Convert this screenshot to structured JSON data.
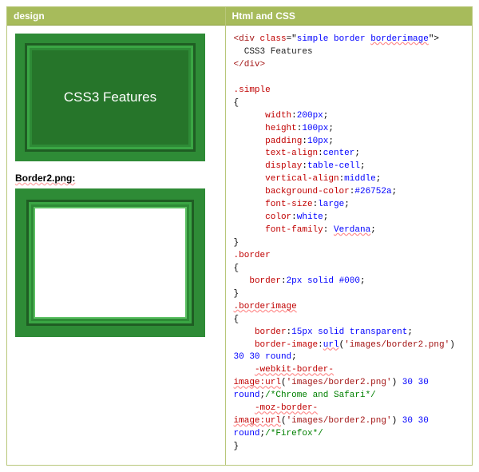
{
  "columns": {
    "left_header": "design",
    "right_header": "Html and CSS"
  },
  "design": {
    "feature_text": "CSS3 Features",
    "frame_label": "Border2.png:"
  },
  "code": {
    "tokens": [
      {
        "t": "tag",
        "v": "<div "
      },
      {
        "t": "attr",
        "v": "class"
      },
      {
        "t": "punc",
        "v": "=\""
      },
      {
        "t": "kw",
        "v": "simple border "
      },
      {
        "t": "kw squiggle",
        "v": "borderimage"
      },
      {
        "t": "punc",
        "v": "\">"
      },
      {
        "t": "nl"
      },
      {
        "t": "txt",
        "v": "  CSS3 Features"
      },
      {
        "t": "nl"
      },
      {
        "t": "tag",
        "v": "</div>"
      },
      {
        "t": "nl"
      },
      {
        "t": "nl"
      },
      {
        "t": "attr",
        "v": ".simple"
      },
      {
        "t": "nl"
      },
      {
        "t": "punc",
        "v": "{"
      },
      {
        "t": "nl"
      },
      {
        "t": "txt",
        "v": "      "
      },
      {
        "t": "attr",
        "v": "width"
      },
      {
        "t": "punc",
        "v": ":"
      },
      {
        "t": "kw",
        "v": "200px"
      },
      {
        "t": "punc",
        "v": ";"
      },
      {
        "t": "nl"
      },
      {
        "t": "txt",
        "v": "      "
      },
      {
        "t": "attr",
        "v": "height"
      },
      {
        "t": "punc",
        "v": ":"
      },
      {
        "t": "kw",
        "v": "100px"
      },
      {
        "t": "punc",
        "v": ";"
      },
      {
        "t": "nl"
      },
      {
        "t": "txt",
        "v": "      "
      },
      {
        "t": "attr",
        "v": "padding"
      },
      {
        "t": "punc",
        "v": ":"
      },
      {
        "t": "kw",
        "v": "10px"
      },
      {
        "t": "punc",
        "v": ";"
      },
      {
        "t": "nl"
      },
      {
        "t": "txt",
        "v": "      "
      },
      {
        "t": "attr",
        "v": "text-align"
      },
      {
        "t": "punc",
        "v": ":"
      },
      {
        "t": "kw",
        "v": "center"
      },
      {
        "t": "punc",
        "v": ";"
      },
      {
        "t": "nl"
      },
      {
        "t": "txt",
        "v": "      "
      },
      {
        "t": "attr",
        "v": "display"
      },
      {
        "t": "punc",
        "v": ":"
      },
      {
        "t": "kw",
        "v": "table-cell"
      },
      {
        "t": "punc",
        "v": ";"
      },
      {
        "t": "nl"
      },
      {
        "t": "txt",
        "v": "      "
      },
      {
        "t": "attr",
        "v": "vertical-align"
      },
      {
        "t": "punc",
        "v": ":"
      },
      {
        "t": "kw",
        "v": "middle"
      },
      {
        "t": "punc",
        "v": ";"
      },
      {
        "t": "nl"
      },
      {
        "t": "txt",
        "v": "      "
      },
      {
        "t": "attr",
        "v": "background-color"
      },
      {
        "t": "punc",
        "v": ":"
      },
      {
        "t": "kw",
        "v": "#26752a"
      },
      {
        "t": "punc",
        "v": ";"
      },
      {
        "t": "nl"
      },
      {
        "t": "txt",
        "v": "      "
      },
      {
        "t": "attr",
        "v": "font-size"
      },
      {
        "t": "punc",
        "v": ":"
      },
      {
        "t": "kw",
        "v": "large"
      },
      {
        "t": "punc",
        "v": ";"
      },
      {
        "t": "nl"
      },
      {
        "t": "txt",
        "v": "      "
      },
      {
        "t": "attr",
        "v": "color"
      },
      {
        "t": "punc",
        "v": ":"
      },
      {
        "t": "kw",
        "v": "white"
      },
      {
        "t": "punc",
        "v": ";"
      },
      {
        "t": "nl"
      },
      {
        "t": "txt",
        "v": "      "
      },
      {
        "t": "attr",
        "v": "font-family"
      },
      {
        "t": "punc",
        "v": ": "
      },
      {
        "t": "kw squiggle",
        "v": "Verdana"
      },
      {
        "t": "punc",
        "v": ";"
      },
      {
        "t": "nl"
      },
      {
        "t": "punc",
        "v": "}"
      },
      {
        "t": "nl"
      },
      {
        "t": "attr",
        "v": ".border"
      },
      {
        "t": "nl"
      },
      {
        "t": "punc",
        "v": "{"
      },
      {
        "t": "nl"
      },
      {
        "t": "txt",
        "v": "   "
      },
      {
        "t": "attr",
        "v": "border"
      },
      {
        "t": "punc",
        "v": ":"
      },
      {
        "t": "kw",
        "v": "2px solid #000"
      },
      {
        "t": "punc",
        "v": ";"
      },
      {
        "t": "nl"
      },
      {
        "t": "punc",
        "v": "}"
      },
      {
        "t": "nl"
      },
      {
        "t": "attr squiggle",
        "v": ".borderimage"
      },
      {
        "t": "nl"
      },
      {
        "t": "punc",
        "v": "{"
      },
      {
        "t": "nl"
      },
      {
        "t": "txt",
        "v": "    "
      },
      {
        "t": "attr",
        "v": "border"
      },
      {
        "t": "punc",
        "v": ":"
      },
      {
        "t": "kw",
        "v": "15px solid transparent"
      },
      {
        "t": "punc",
        "v": ";"
      },
      {
        "t": "nl"
      },
      {
        "t": "txt",
        "v": "    "
      },
      {
        "t": "attr",
        "v": "border-image"
      },
      {
        "t": "punc",
        "v": ":"
      },
      {
        "t": "kw squiggle",
        "v": "url"
      },
      {
        "t": "punc",
        "v": "("
      },
      {
        "t": "tag",
        "v": "'images/border2.png'"
      },
      {
        "t": "punc",
        "v": ")"
      },
      {
        "t": "nl"
      },
      {
        "t": "kw",
        "v": "30 30 round"
      },
      {
        "t": "punc",
        "v": ";"
      },
      {
        "t": "nl"
      },
      {
        "t": "txt",
        "v": "    "
      },
      {
        "t": "attr squiggle",
        "v": "-webkit-border-"
      },
      {
        "t": "nl"
      },
      {
        "t": "attr squiggle",
        "v": "image:url"
      },
      {
        "t": "punc",
        "v": "("
      },
      {
        "t": "tag",
        "v": "'images/border2.png'"
      },
      {
        "t": "punc",
        "v": ") "
      },
      {
        "t": "kw",
        "v": "30 30"
      },
      {
        "t": "nl"
      },
      {
        "t": "kw",
        "v": "round"
      },
      {
        "t": "punc",
        "v": ";"
      },
      {
        "t": "cmt",
        "v": "/*Chrome and Safari*/"
      },
      {
        "t": "nl"
      },
      {
        "t": "txt",
        "v": "    "
      },
      {
        "t": "attr squiggle",
        "v": "-moz-border-"
      },
      {
        "t": "nl"
      },
      {
        "t": "attr squiggle",
        "v": "image:url"
      },
      {
        "t": "punc",
        "v": "("
      },
      {
        "t": "tag",
        "v": "'images/border2.png'"
      },
      {
        "t": "punc",
        "v": ") "
      },
      {
        "t": "kw",
        "v": "30 30"
      },
      {
        "t": "nl"
      },
      {
        "t": "kw",
        "v": "round"
      },
      {
        "t": "punc",
        "v": ";"
      },
      {
        "t": "cmt",
        "v": "/*Firefox*/"
      },
      {
        "t": "nl"
      },
      {
        "t": "punc",
        "v": "}"
      }
    ]
  }
}
